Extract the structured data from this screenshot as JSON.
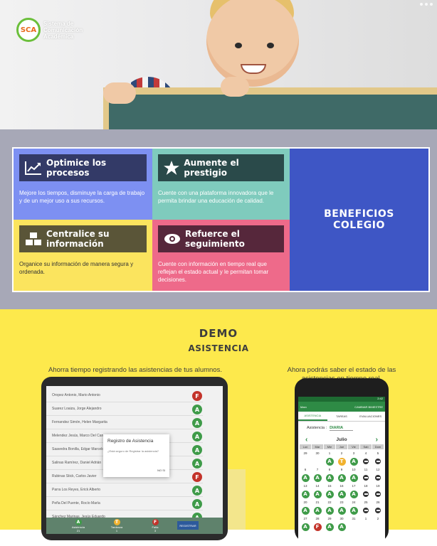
{
  "brand": {
    "logo_text": "SCA",
    "name": "Sistema de Comunicación Académica"
  },
  "benefits": {
    "title": "BENEFICIOS COLEGIO",
    "items": [
      {
        "icon": "chart-line-icon",
        "label": "Optimice los procesos",
        "text": "Mejore los tiempos, disminuye la carga de trabajo y de un mejor uso a sus recursos."
      },
      {
        "icon": "star-icon",
        "label": "Aumente el prestigio",
        "text": "Cuente con una plataforma innovadora que le permita brindar una educación de calidad."
      },
      {
        "icon": "cubes-icon",
        "label": "Centralice su información",
        "text": "Organice su información de manera segura y ordenada."
      },
      {
        "icon": "eye-icon",
        "label": "Refuerce el seguimiento",
        "text": "Cuente con información en tiempo real que reflejan el estado actual y le permitan tomar decisiones."
      }
    ],
    "colors": {
      "c1": "#7d90f2",
      "c2": "#7fcbbd",
      "c3": "#fbe45e",
      "c4": "#ee6a8a",
      "big": "#3e56c5"
    }
  },
  "demo": {
    "title": "DEMO",
    "subtitle": "ASISTENCIA",
    "caption_left": "Ahorra tiempo registrando las asistencias de tus alumnos.",
    "caption_right": "Ahora podrás saber el estado de las asistencias en tiempo real."
  },
  "tablet": {
    "students": [
      {
        "name": "Oropez Antonio, Mario Antonio",
        "status": "F"
      },
      {
        "name": "Suarez Loaiza, Jorge Alejandro",
        "status": "A"
      },
      {
        "name": "Fernandez Simón, Helen Margarita",
        "status": "A"
      },
      {
        "name": "Melendez Jesús, Marco Del Carmen",
        "status": "A"
      },
      {
        "name": "Saavedra Bonilla, Edgar Marcelo",
        "status": "A"
      },
      {
        "name": "Salinas Ramírez, Daniel Adrián",
        "status": "A"
      },
      {
        "name": "Rubinas Stick, Carlos Javier",
        "status": "F"
      },
      {
        "name": "Parra Los Reyes, Erick Alberto",
        "status": "A"
      },
      {
        "name": "Peña Del Puente, Rocío María",
        "status": "A"
      },
      {
        "name": "Sánchez Marinas, Jesús Eduardo",
        "status": "A"
      }
    ],
    "modal": {
      "title": "Registro de Asistencia",
      "text": "¿Está seguro de Registrar la asistencia?",
      "ok": "NO   SI"
    },
    "footer": [
      {
        "label": "Asistencia",
        "count": "21",
        "status": "A"
      },
      {
        "label": "Tardanza",
        "count": "1",
        "status": "T"
      },
      {
        "label": "Falta",
        "count": "3",
        "status": "F"
      }
    ],
    "register_button": "REGISTRAR"
  },
  "phone": {
    "status_time": "2:42",
    "app_name": "Marx",
    "header_action": "CAMBIAR BIMESTRE",
    "tabs": [
      "ASISTENCIA",
      "TAREAS",
      "EVALUACIONES"
    ],
    "field_label": "Asistencia :",
    "field_value": "DIARIA",
    "month": "Julio",
    "weekdays": [
      "Lun",
      "Mar",
      "Mie",
      "Jue",
      "Vie",
      "Sab",
      "Dom"
    ],
    "weeks": [
      {
        "days": [
          "29",
          "30",
          "1",
          "2",
          "3",
          "4",
          "5"
        ],
        "marks": [
          "",
          "",
          "A",
          "T",
          "A",
          "-",
          "-"
        ]
      },
      {
        "days": [
          "6",
          "7",
          "8",
          "9",
          "10",
          "11",
          "12"
        ],
        "marks": [
          "A",
          "A",
          "A",
          "A",
          "A",
          "-",
          "-"
        ]
      },
      {
        "days": [
          "13",
          "14",
          "15",
          "16",
          "17",
          "18",
          "19"
        ],
        "marks": [
          "A",
          "A",
          "A",
          "A",
          "A",
          "-",
          "-"
        ]
      },
      {
        "days": [
          "20",
          "21",
          "22",
          "23",
          "24",
          "25",
          "26"
        ],
        "marks": [
          "A",
          "A",
          "A",
          "A",
          "A",
          "-",
          "-"
        ]
      },
      {
        "days": [
          "27",
          "28",
          "29",
          "30",
          "31",
          "1",
          "2"
        ],
        "marks": [
          "A",
          "F",
          "A",
          "A",
          "",
          "",
          ""
        ]
      }
    ]
  }
}
